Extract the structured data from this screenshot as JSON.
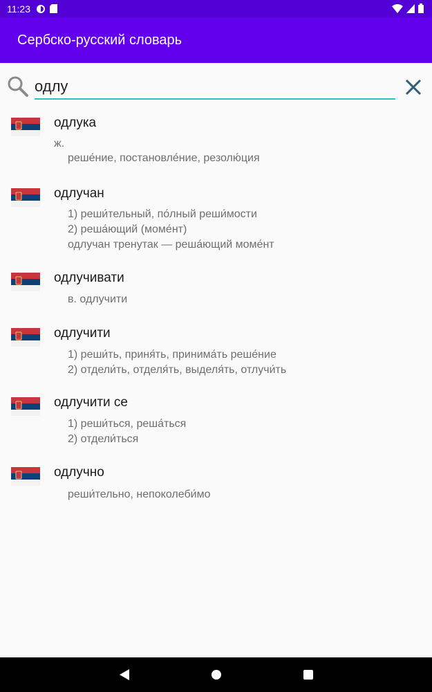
{
  "status_bar": {
    "time": "11:23"
  },
  "app_bar": {
    "title": "Сербско-русский словарь"
  },
  "search": {
    "value": "одлу",
    "icon": "search-icon",
    "clear_icon": "close-icon"
  },
  "entries": [
    {
      "word": "одлука",
      "gender": "ж.",
      "lines": [
        "реше́ние, постановле́ние, резолю́ция"
      ]
    },
    {
      "word": "одлучан",
      "lines": [
        "1) реши́тельный, по́лный реши́мости",
        "2) реша́ющий   (моме́нт)",
        "одлучан тренутак — реша́ющий моме́нт"
      ]
    },
    {
      "word": "одлучивати",
      "lines": [
        "в. одлучити"
      ]
    },
    {
      "word": "одлучити",
      "lines": [
        "1) реши́ть, приня́ть, принима́ть реше́ние",
        "2) отдели́ть, отделя́ть, выделя́ть, отлучи́ть"
      ]
    },
    {
      "word": "одлучити се",
      "lines": [
        "1) реши́ться, реша́ться",
        "2) отдели́ться"
      ]
    },
    {
      "word": "одлучно",
      "lines": [
        "реши́тельно, непоколеби́мо"
      ]
    }
  ],
  "colors": {
    "status": "#5200d6",
    "app_bar": "#6200ee",
    "accent": "#27c2cc",
    "flag_red": "#c6363c",
    "flag_blue": "#0c4076"
  }
}
